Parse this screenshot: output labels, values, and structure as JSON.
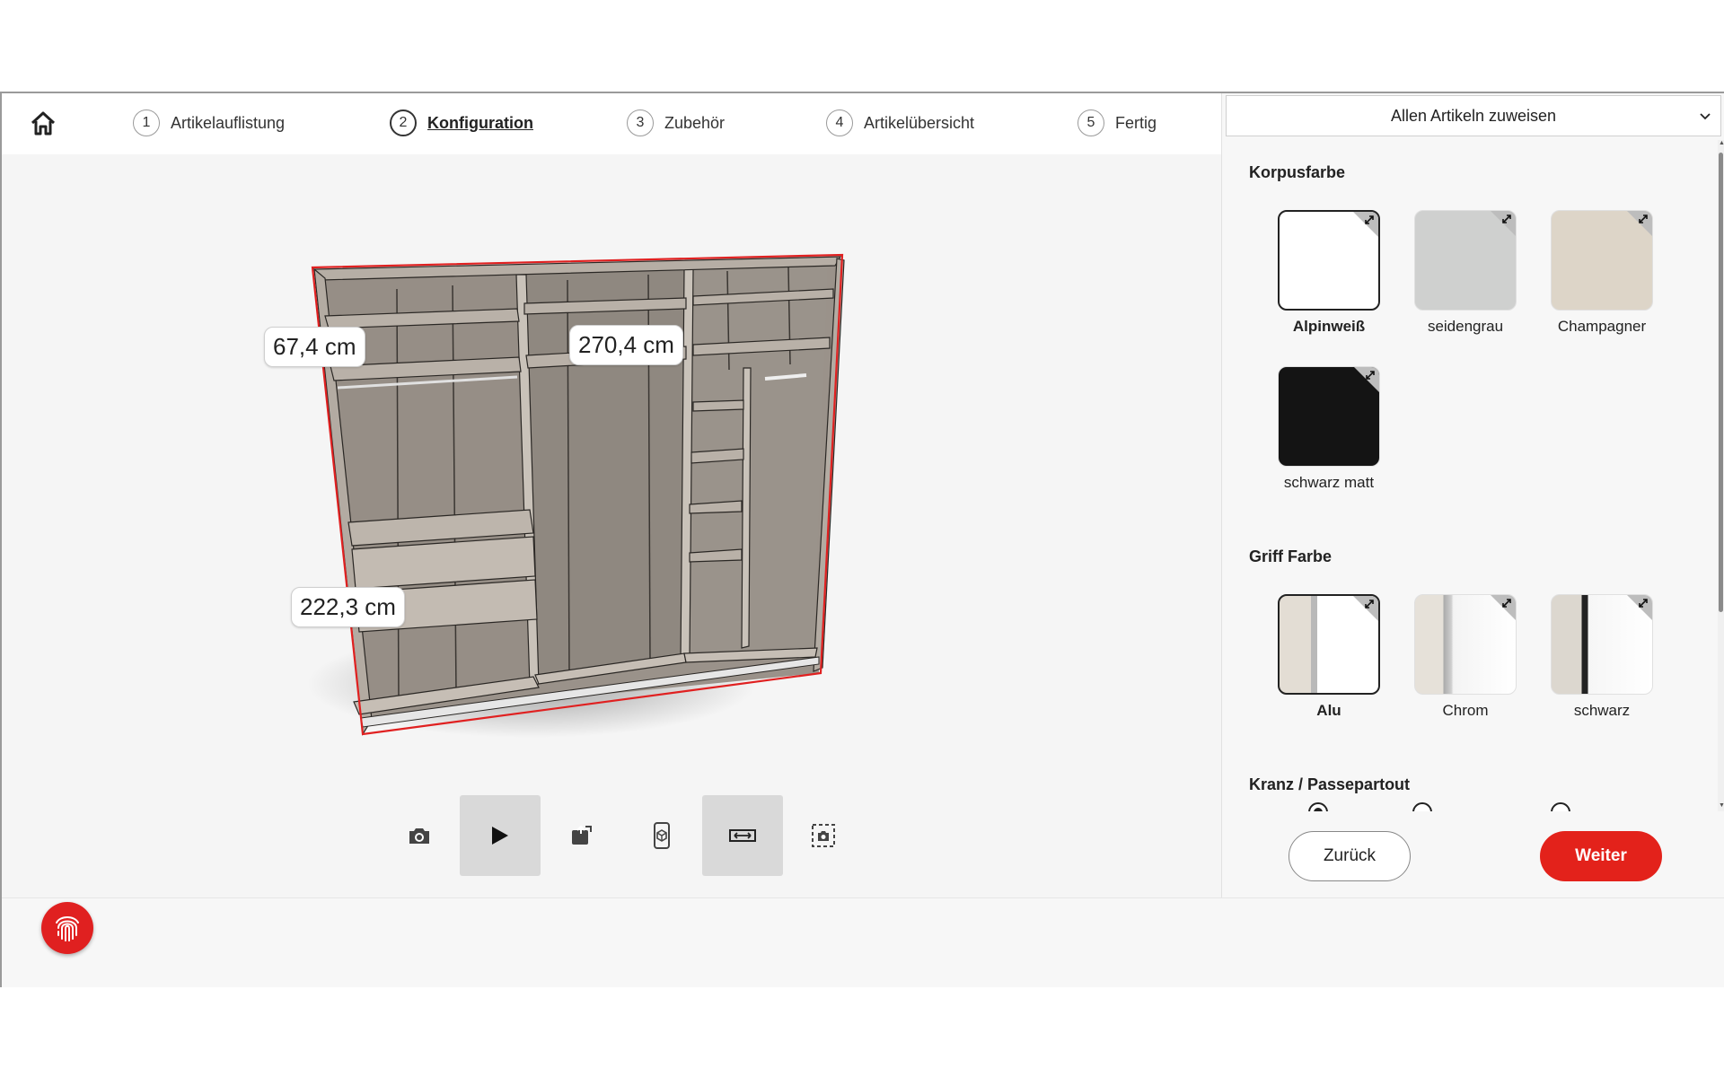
{
  "stepper": {
    "steps": [
      {
        "num": "1",
        "label": "Artikelauflistung"
      },
      {
        "num": "2",
        "label": "Konfiguration"
      },
      {
        "num": "3",
        "label": "Zubehör"
      },
      {
        "num": "4",
        "label": "Artikelübersicht"
      },
      {
        "num": "5",
        "label": "Fertig"
      }
    ],
    "active_step": 2
  },
  "viewer": {
    "dimensions": {
      "depth": "67,4 cm",
      "width": "270,4 cm",
      "height": "222,3 cm"
    },
    "toolbar": [
      {
        "icon": "camera-icon",
        "active": false
      },
      {
        "icon": "play-icon",
        "active": true
      },
      {
        "icon": "ar-icon",
        "active": false
      },
      {
        "icon": "mobile-3d-icon",
        "active": false
      },
      {
        "icon": "measure-icon",
        "active": true
      },
      {
        "icon": "screenshot-icon",
        "active": false
      }
    ]
  },
  "panel": {
    "assign_select": "Allen Artikeln zuweisen",
    "korpus": {
      "title": "Korpusfarbe",
      "options": [
        {
          "name": "Alpinweiß",
          "color": "#ffffff",
          "selected": true
        },
        {
          "name": "seidengrau",
          "color": "#cfd0cf",
          "selected": false
        },
        {
          "name": "Champagner",
          "color": "#ddd5c8",
          "selected": false
        },
        {
          "name": "schwarz matt",
          "color": "#141414",
          "selected": false
        }
      ]
    },
    "griff": {
      "title": "Griff Farbe",
      "options": [
        {
          "name": "Alu",
          "color": "#b9b9b9",
          "selected": true
        },
        {
          "name": "Chrom",
          "color": "#a8a8a8",
          "selected": false
        },
        {
          "name": "schwarz",
          "color": "#222222",
          "selected": false
        }
      ]
    },
    "kranz": {
      "title": "Kranz / Passepartout"
    },
    "back_label": "Zurück",
    "next_label": "Weiter"
  },
  "colors": {
    "accent": "#e3221b",
    "outline": "#e02020"
  }
}
